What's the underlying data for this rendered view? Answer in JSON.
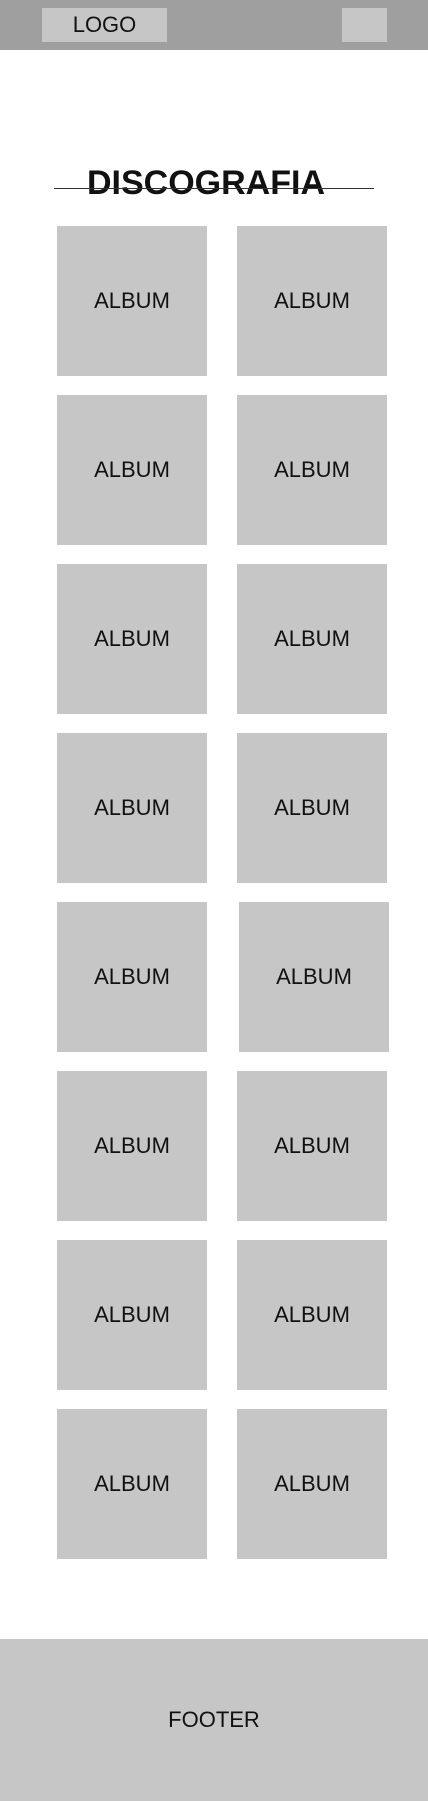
{
  "header": {
    "logo_label": "LOGO"
  },
  "main": {
    "title": "DISCOGRAFIA",
    "albums": [
      {
        "label": "ALBUM"
      },
      {
        "label": "ALBUM"
      },
      {
        "label": "ALBUM"
      },
      {
        "label": "ALBUM"
      },
      {
        "label": "ALBUM"
      },
      {
        "label": "ALBUM"
      },
      {
        "label": "ALBUM"
      },
      {
        "label": "ALBUM"
      },
      {
        "label": "ALBUM"
      },
      {
        "label": "ALBUM"
      },
      {
        "label": "ALBUM"
      },
      {
        "label": "ALBUM"
      },
      {
        "label": "ALBUM"
      },
      {
        "label": "ALBUM"
      },
      {
        "label": "ALBUM"
      },
      {
        "label": "ALBUM"
      }
    ]
  },
  "footer": {
    "label": "FOOTER"
  },
  "colors": {
    "header_background": "#9f9f9f",
    "placeholder_gray": "#c6c6c6",
    "page_background": "#ffffff",
    "text": "#111111",
    "rule": "#333333"
  }
}
